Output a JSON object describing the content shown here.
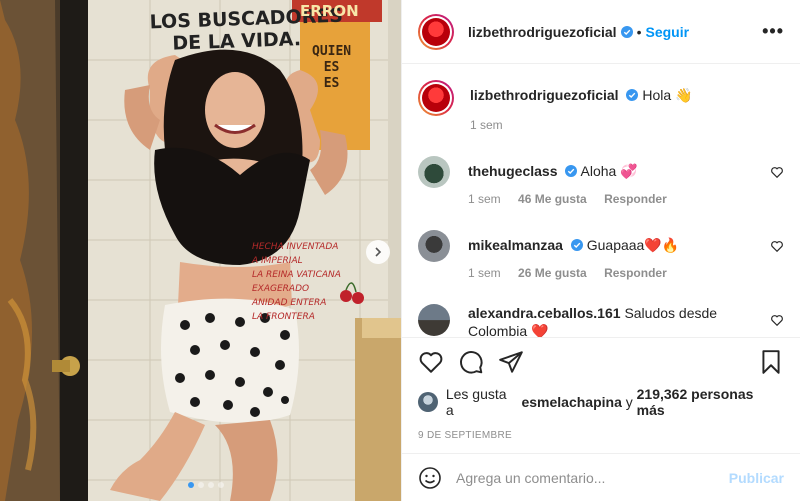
{
  "header": {
    "username": "lizbethrodriguezoficial",
    "separator": "•",
    "follow_label": "Seguir",
    "more_label": "•••"
  },
  "caption": {
    "username": "lizbethrodriguezoficial",
    "text": "Hola 👋",
    "time": "1 sem"
  },
  "comments": [
    {
      "username": "thehugeclass",
      "verified": true,
      "text": "Aloha 💞",
      "time": "1 sem",
      "likes": "46 Me gusta",
      "reply": "Responder"
    },
    {
      "username": "mikealmanzaa",
      "verified": true,
      "text": "Guapaaa❤️🔥",
      "time": "1 sem",
      "likes": "26 Me gusta",
      "reply": "Responder"
    },
    {
      "username": "alexandra.ceballos.161",
      "verified": false,
      "text": "Saludos desde Colombia ❤️",
      "time": "",
      "likes": "",
      "reply": ""
    }
  ],
  "likes": {
    "prefix": "Les gusta a",
    "user": "esmelachapina",
    "conj": "y",
    "count": "219,362 personas más"
  },
  "date": "9 DE SEPTIEMBRE",
  "add_comment": {
    "placeholder": "Agrega un comentario...",
    "publish_label": "Publicar"
  },
  "photo": {
    "wall_text_top": "LOS BUSCADORES",
    "wall_text_top2": "DE LA VIDA.",
    "sign_top": "ERRON",
    "sign_lines": [
      "QUIEN",
      "ES",
      "ES"
    ],
    "wall_lines": [
      "HECHA INVENTADA",
      "A IMPERIAL",
      "LA REINA VATICANA",
      "EXAGERADO",
      "ANIDAD ENTERA",
      "LA FRONTERA"
    ]
  },
  "carousel": {
    "slides": 4,
    "active": 1
  },
  "colors": {
    "accent": "#0095f6",
    "verified": "#3897f0",
    "text": "#262626",
    "muted": "#8e8e8e",
    "border": "#efefef"
  }
}
